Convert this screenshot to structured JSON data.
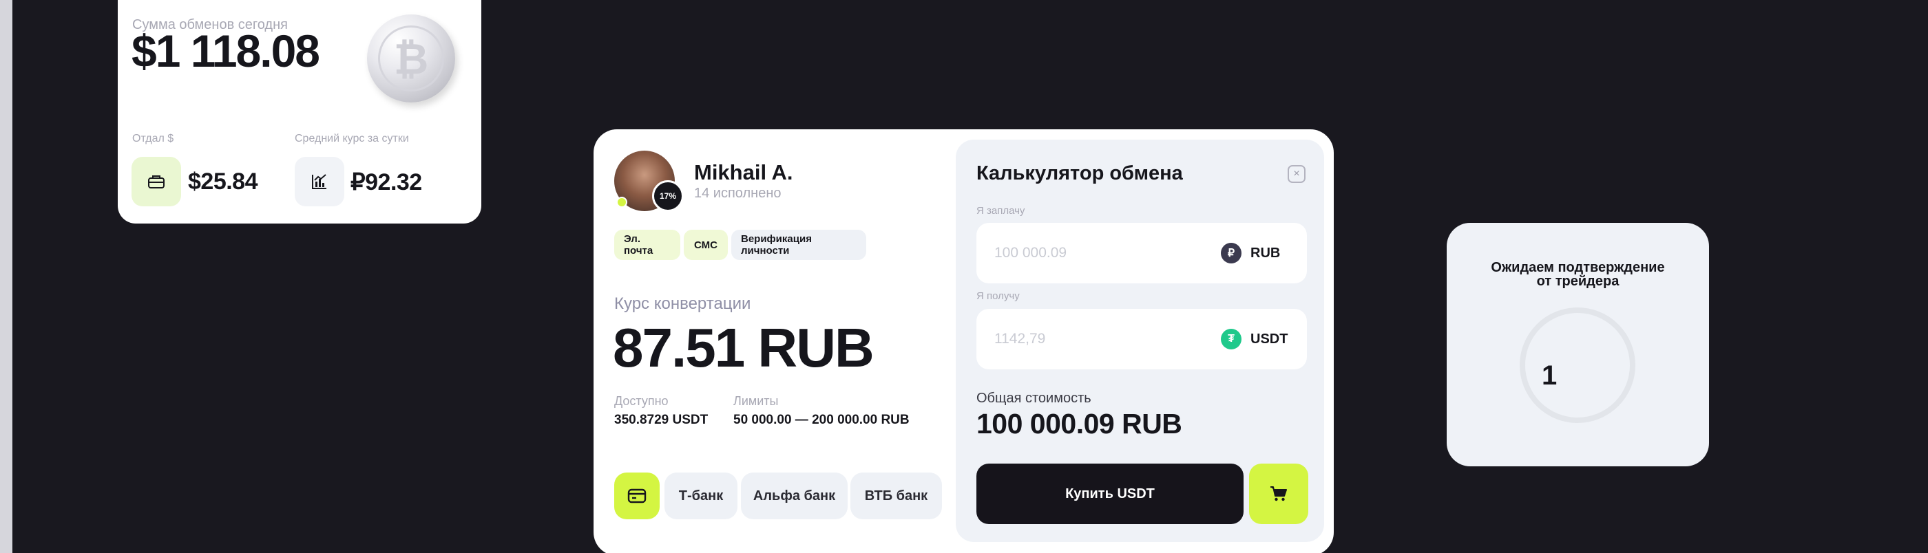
{
  "summary": {
    "label": "Сумма обменов сегодня",
    "amount": "$1 118.08",
    "given_label": "Отдал $",
    "given_value": "$25.84",
    "avg_label": "Средний курс за сутки",
    "avg_value": "₽92.32",
    "coin_icon": "bitcoin-coin-icon"
  },
  "trader": {
    "name": "Mikhail A.",
    "deals": "14 исполнено",
    "completion_badge": "17%",
    "online": true,
    "verifications": [
      "Эл. почта",
      "СМС",
      "Верификация личности"
    ],
    "rate_label": "Курс конвертации",
    "rate_value": "87.51 RUB",
    "available_label": "Доступно",
    "available_value": "350.8729 USDT",
    "limits_label": "Лимиты",
    "limits_value": "50 000.00 — 200 000.00 RUB",
    "banks": [
      "Т-банк",
      "Альфа банк",
      "ВТБ банк"
    ]
  },
  "calculator": {
    "title": "Калькулятор обмена",
    "close_icon": "×",
    "pay_label": "Я заплачу",
    "pay_value": "100 000.09",
    "pay_currency": "RUB",
    "pay_currency_symbol": "₽",
    "receive_label": "Я получу",
    "receive_value": "1142,79",
    "receive_currency": "USDT",
    "receive_currency_symbol": "₮",
    "total_label": "Общая стоимость",
    "total_value": "100 000.09 RUB",
    "buy_label": "Купить USDT"
  },
  "waiting": {
    "line1": "Ожидаем подтверждение",
    "line2": "от трейдера",
    "counter": "1"
  },
  "colors": {
    "background": "#19181f",
    "accent": "#d4f542",
    "rub": "#3b3a4f",
    "usdt": "#1fc98b"
  }
}
